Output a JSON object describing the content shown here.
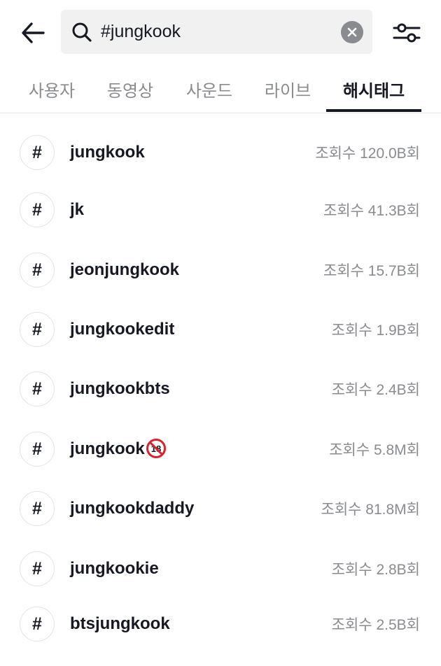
{
  "search": {
    "query": "#jungkook"
  },
  "tabs": [
    "사용자",
    "동영상",
    "사운드",
    "라이브",
    "해시태그"
  ],
  "active_tab": "해시태그",
  "results": [
    {
      "tag": "jungkook",
      "views": "조회수 120.0B회"
    },
    {
      "tag": "jk",
      "views": "조회수 41.3B회"
    },
    {
      "tag": "jeonjungkook",
      "views": "조회수 15.7B회"
    },
    {
      "tag": "jungkookedit",
      "views": "조회수 1.9B회"
    },
    {
      "tag": "jungkookbts",
      "views": "조회수 2.4B회"
    },
    {
      "tag": "jungkook",
      "views": "조회수 5.8M회",
      "suffix_icon": "no-under-18-emoji"
    },
    {
      "tag": "jungkookdaddy",
      "views": "조회수 81.8M회"
    },
    {
      "tag": "jungkookie",
      "views": "조회수 2.8B회"
    },
    {
      "tag": "btsjungkook",
      "views": "조회수 2.5B회"
    }
  ],
  "hash_symbol": "#",
  "colors": {
    "text": "#161823",
    "secondary": "#8a8b91",
    "search_bg": "#f1f1f2"
  }
}
